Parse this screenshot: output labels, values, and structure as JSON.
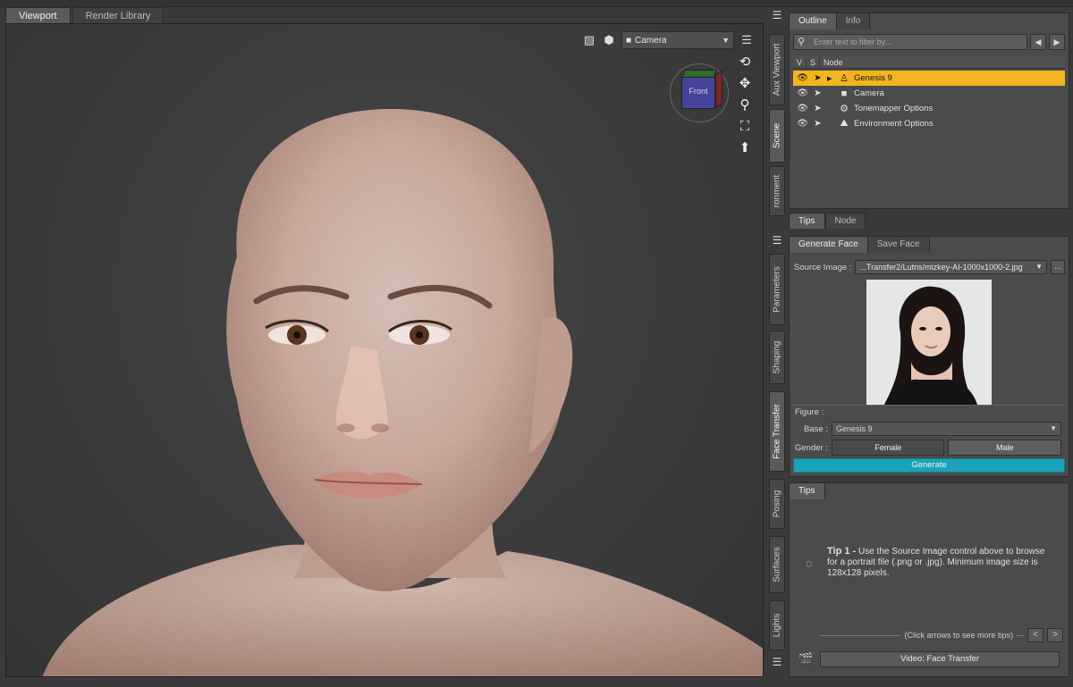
{
  "viewport_tabs": [
    "Viewport",
    "Render Library"
  ],
  "camera_select": "Camera",
  "nav_cube_label": "Front",
  "side_tabs_top": [
    "Aux Viewport",
    "Scene",
    "ronment"
  ],
  "side_tabs_bottom": [
    "Parameters",
    "Shaping",
    "Face Transfer",
    "Posing",
    "Surfaces",
    "Lights"
  ],
  "outline": {
    "tabs": [
      "Outline",
      "Info"
    ],
    "filter_placeholder": "Enter text to filter by...",
    "columns": [
      "V",
      "S",
      "Node"
    ],
    "nodes": [
      "Genesis 9",
      "Camera",
      "Tonemapper Options",
      "Environment Options"
    ]
  },
  "lower_tabs": [
    "Tips",
    "Node"
  ],
  "face_transfer": {
    "tabs": [
      "Generate Face",
      "Save Face"
    ],
    "source_label": "Source Image :",
    "source_value": "...Transfer2/Lutris/mizkey-AI-1000x1000-2.jpg",
    "browse": "...",
    "figure_label": "Figure :",
    "base_label": "Base :",
    "base_value": "Genesis 9",
    "gender_label": "Gender :",
    "gender_female": "Female",
    "gender_male": "Male",
    "generate": "Generate"
  },
  "tips": {
    "tab": "Tips",
    "tip_title": "Tip 1 -",
    "tip_body": "Use the Source Image control above to browse for a portrait file (.png or .jpg). Minimum image size is 128x128 pixels.",
    "nav_hint": "(Click arrows to see more tips)",
    "prev": "<",
    "next": ">",
    "video": "Video: Face Transfer"
  },
  "colors": {
    "selection": "#f2b51f",
    "generate": "#1aa3b8"
  }
}
